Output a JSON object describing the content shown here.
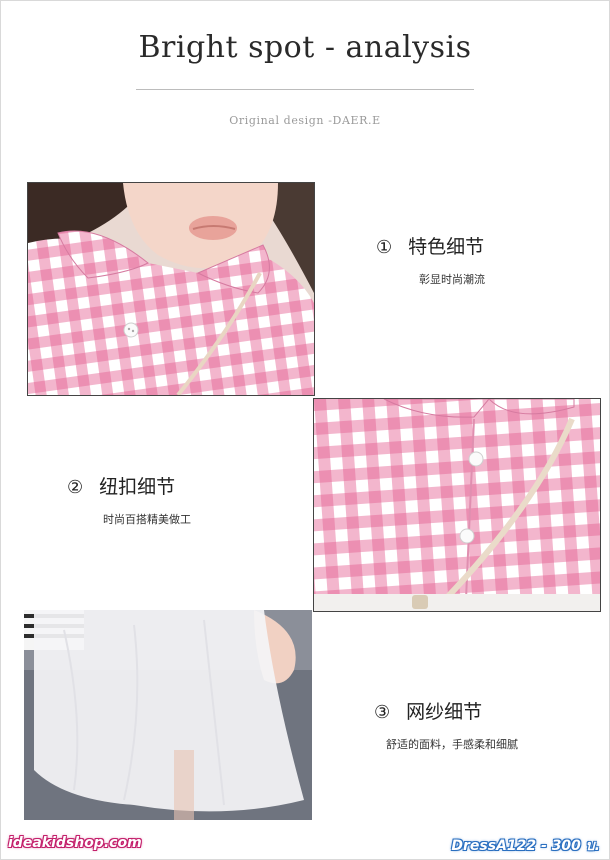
{
  "header": {
    "title": "Bright spot - analysis",
    "subtitle": "Original design -DAER.E"
  },
  "features": [
    {
      "number": "①",
      "title": "特色细节",
      "description": "彰显时尚潮流"
    },
    {
      "number": "②",
      "title": "纽扣细节",
      "description": "时尚百搭精美做工"
    },
    {
      "number": "③",
      "title": "网纱细节",
      "description": "舒适的面料，手感柔和细腻"
    }
  ],
  "footer": {
    "site": "ideakidshop.com",
    "price": "DressA122 - 300 บ."
  },
  "colors": {
    "gingham_pink": "#f1a7c4",
    "gingham_white": "#ffffff",
    "site_outline": "#c31f6b",
    "price_outline": "#2a6fc0"
  }
}
